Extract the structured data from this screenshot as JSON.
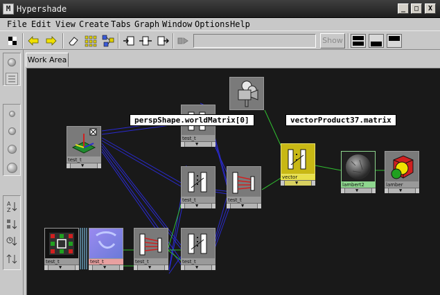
{
  "window": {
    "title": "Hypershade",
    "icon_letter": "M",
    "controls": [
      "_",
      "□",
      "X"
    ]
  },
  "menu": [
    "File",
    "Edit",
    "View",
    "Create",
    "Tabs",
    "Graph",
    "Window",
    "Options",
    "Help"
  ],
  "toolbar": {
    "buttons": [
      "checker-icon",
      "arrow-left-icon",
      "arrow-right-icon",
      "eraser-icon",
      "grid-icon",
      "graph-network-icon",
      "input-connections-icon",
      "input-output-icon",
      "output-connections-icon",
      "bookmark-icon"
    ],
    "path_value": "",
    "show_label": "Show",
    "layouts": [
      "top-bottom-layout-icon",
      "bottom-only-layout-icon",
      "top-only-layout-icon"
    ]
  },
  "tabs": [
    {
      "label": "Work Area",
      "active": true
    }
  ],
  "graph": {
    "nodes": [
      {
        "id": "n1",
        "label": "test_t",
        "style": "gray",
        "icon": "place3d-texture-icon"
      },
      {
        "id": "n2",
        "label": "test_t",
        "style": "gray",
        "icon": "multiply-divide-icon"
      },
      {
        "id": "n3",
        "label": "test_t",
        "style": "gray",
        "icon": "multiply-divide-icon"
      },
      {
        "id": "n4",
        "label": "test_t",
        "style": "gray",
        "icon": "multiply-divide-icon"
      },
      {
        "id": "n5",
        "label": "test_t",
        "style": "gray",
        "icon": "color-swatch-icon"
      },
      {
        "id": "n6",
        "label": "test_t",
        "style": "pink",
        "icon": "normal-map-icon"
      },
      {
        "id": "n7",
        "label": "test_t",
        "style": "gray",
        "icon": "plus-minus-average-icon"
      },
      {
        "id": "n8",
        "label": "test_t",
        "style": "gray",
        "icon": "plus-minus-average-icon"
      },
      {
        "id": "n9",
        "label": "",
        "style": "gray",
        "icon": "camera-icon"
      },
      {
        "id": "n10",
        "label": "vector",
        "style": "yellow",
        "icon": "vector-product-icon"
      },
      {
        "id": "n11",
        "label": "lambert2",
        "style": "green",
        "icon": "lambert-sphere-icon"
      },
      {
        "id": "n12",
        "label": "lamber",
        "style": "gray",
        "icon": "shading-group-icon"
      }
    ],
    "tooltips": [
      "perspShape.worldMatrix[0]",
      "vectorProduct37.matrix"
    ]
  },
  "colors": {
    "workarea_bg": "#191919",
    "connection_blue": "#2a2ad0",
    "connection_green": "#30c030",
    "selected_node": "#c8b814",
    "material_node": "#8ed68e"
  }
}
